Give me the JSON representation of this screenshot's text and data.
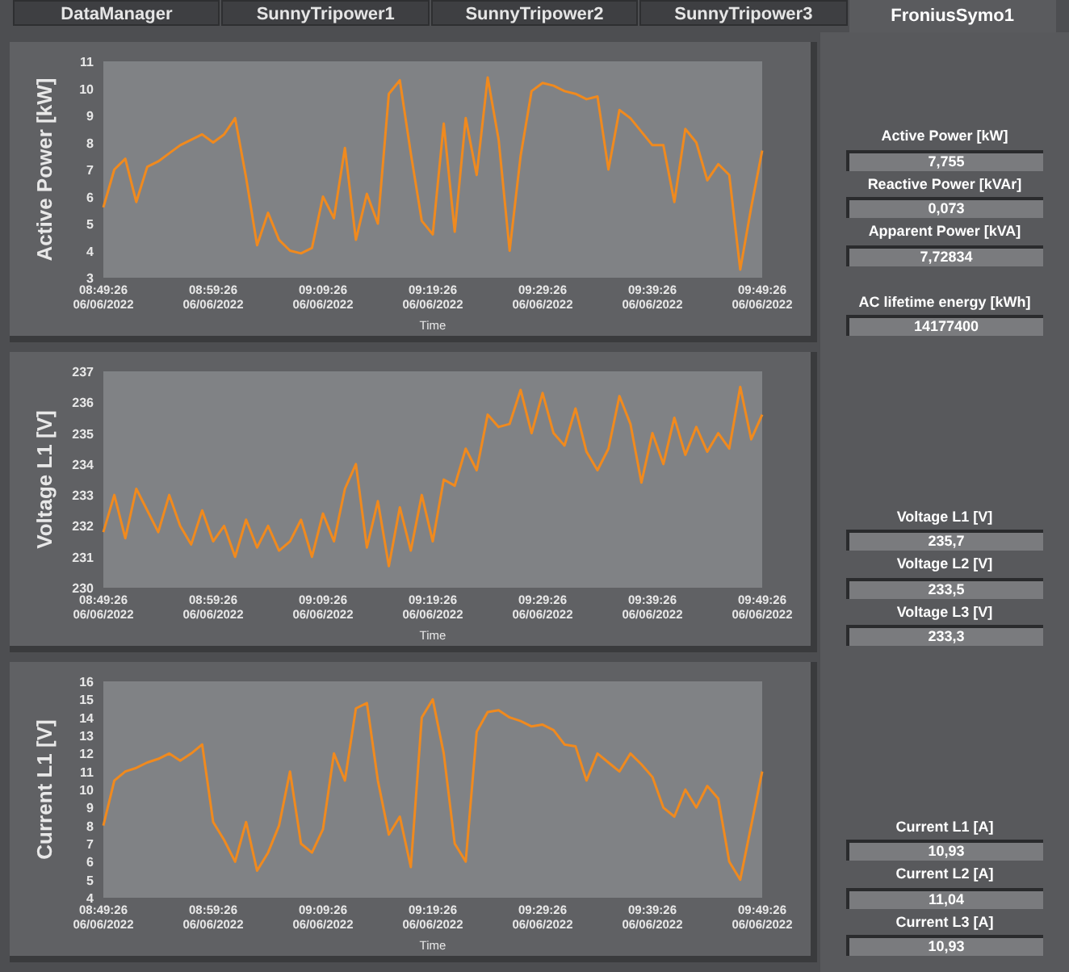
{
  "tabs": [
    {
      "label": "DataManager",
      "selected": false
    },
    {
      "label": "SunnyTripower1",
      "selected": false
    },
    {
      "label": "SunnyTripower2",
      "selected": false
    },
    {
      "label": "SunnyTripower3",
      "selected": false
    },
    {
      "label": "FroniusSymo1",
      "selected": true
    }
  ],
  "charts": [
    {
      "chart_data": {
        "type": "line",
        "xlabel": "Time",
        "ylabel": "Active Power [kW]",
        "categories": [
          "08:49:26\n06/06/2022",
          null,
          null,
          null,
          null,
          null,
          null,
          null,
          null,
          null,
          "08:59:26\n06/06/2022",
          null,
          null,
          null,
          null,
          null,
          null,
          null,
          null,
          null,
          "09:09:26\n06/06/2022",
          null,
          null,
          null,
          null,
          null,
          null,
          null,
          null,
          null,
          "09:19:26\n06/06/2022",
          null,
          null,
          null,
          null,
          null,
          null,
          null,
          null,
          null,
          "09:29:26\n06/06/2022",
          null,
          null,
          null,
          null,
          null,
          null,
          null,
          null,
          null,
          "09:39:26\n06/06/2022",
          null,
          null,
          null,
          null,
          null,
          null,
          null,
          null,
          null,
          "09:49:26\n06/06/2022"
        ],
        "series": [
          {
            "color": "#f08a1e",
            "values": [
              5.6,
              7.0,
              7.4,
              5.8,
              7.1,
              7.3,
              7.6,
              7.9,
              8.1,
              8.3,
              8.0,
              8.3,
              8.9,
              6.7,
              4.2,
              5.4,
              4.4,
              4.0,
              3.9,
              4.1,
              6.0,
              5.2,
              7.8,
              4.4,
              6.1,
              5.0,
              9.8,
              10.3,
              7.6,
              5.1,
              4.6,
              8.7,
              4.7,
              8.9,
              6.8,
              10.4,
              8.1,
              4.0,
              7.5,
              9.9,
              10.2,
              10.1,
              9.9,
              9.8,
              9.6,
              9.7,
              7.0,
              9.2,
              8.9,
              8.4,
              7.9,
              7.9,
              5.8,
              8.5,
              8.0,
              6.6,
              7.2,
              6.8,
              3.3,
              5.6,
              7.7
            ]
          }
        ],
        "ylim": [
          3,
          11
        ],
        "yticks": [
          3,
          4,
          5,
          6,
          7,
          8,
          9,
          10,
          11
        ]
      },
      "readouts": [
        {
          "label": "Active Power [kW]",
          "value": "7,755"
        },
        {
          "label": "Reactive Power [kVAr]",
          "value": "0,073"
        },
        {
          "label": "Apparent Power [kVA]",
          "value": "7,72834"
        },
        {
          "label": "AC lifetime energy [kWh]",
          "value": "14177400"
        }
      ]
    },
    {
      "chart_data": {
        "type": "line",
        "xlabel": "Time",
        "ylabel": "Voltage L1 [V]",
        "categories": [
          "08:49:26\n06/06/2022",
          null,
          null,
          null,
          null,
          null,
          null,
          null,
          null,
          null,
          "08:59:26\n06/06/2022",
          null,
          null,
          null,
          null,
          null,
          null,
          null,
          null,
          null,
          "09:09:26\n06/06/2022",
          null,
          null,
          null,
          null,
          null,
          null,
          null,
          null,
          null,
          "09:19:26\n06/06/2022",
          null,
          null,
          null,
          null,
          null,
          null,
          null,
          null,
          null,
          "09:29:26\n06/06/2022",
          null,
          null,
          null,
          null,
          null,
          null,
          null,
          null,
          null,
          "09:39:26\n06/06/2022",
          null,
          null,
          null,
          null,
          null,
          null,
          null,
          null,
          null,
          "09:49:26\n06/06/2022"
        ],
        "series": [
          {
            "color": "#f08a1e",
            "values": [
              231.8,
              233.0,
              231.6,
              233.2,
              232.5,
              231.8,
              233.0,
              232.0,
              231.4,
              232.5,
              231.5,
              232.0,
              231.0,
              232.2,
              231.3,
              232.0,
              231.2,
              231.5,
              232.2,
              231.0,
              232.4,
              231.5,
              233.2,
              234.0,
              231.3,
              232.8,
              230.7,
              232.6,
              231.2,
              233.0,
              231.5,
              233.5,
              233.3,
              234.5,
              233.8,
              235.6,
              235.2,
              235.3,
              236.4,
              235.0,
              236.3,
              235.0,
              234.6,
              235.8,
              234.4,
              233.8,
              234.5,
              236.2,
              235.3,
              233.4,
              235.0,
              234.0,
              235.5,
              234.3,
              235.2,
              234.4,
              235.0,
              234.5,
              236.5,
              234.8,
              235.6
            ]
          }
        ],
        "ylim": [
          230,
          237
        ],
        "yticks": [
          230,
          231,
          232,
          233,
          234,
          235,
          236,
          237
        ]
      },
      "readouts": [
        {
          "label": "Voltage L1 [V]",
          "value": "235,7"
        },
        {
          "label": "Voltage L2 [V]",
          "value": "233,5"
        },
        {
          "label": "Voltage L3 [V]",
          "value": "233,3"
        }
      ]
    },
    {
      "chart_data": {
        "type": "line",
        "xlabel": "Time",
        "ylabel": "Current L1 [V]",
        "categories": [
          "08:49:26\n06/06/2022",
          null,
          null,
          null,
          null,
          null,
          null,
          null,
          null,
          null,
          "08:59:26\n06/06/2022",
          null,
          null,
          null,
          null,
          null,
          null,
          null,
          null,
          null,
          "09:09:26\n06/06/2022",
          null,
          null,
          null,
          null,
          null,
          null,
          null,
          null,
          null,
          "09:19:26\n06/06/2022",
          null,
          null,
          null,
          null,
          null,
          null,
          null,
          null,
          null,
          "09:29:26\n06/06/2022",
          null,
          null,
          null,
          null,
          null,
          null,
          null,
          null,
          null,
          "09:39:26\n06/06/2022",
          null,
          null,
          null,
          null,
          null,
          null,
          null,
          null,
          null,
          "09:49:26\n06/06/2022"
        ],
        "series": [
          {
            "color": "#f08a1e",
            "values": [
              8,
              10.5,
              11,
              11.2,
              11.5,
              11.7,
              12,
              11.6,
              12,
              12.5,
              8.2,
              7.2,
              6,
              8.2,
              5.5,
              6.5,
              8,
              11,
              7,
              6.5,
              7.8,
              12,
              10.5,
              14.5,
              14.8,
              10.5,
              7.5,
              8.5,
              5.7,
              14,
              15,
              12,
              7,
              6,
              13.2,
              14.3,
              14.4,
              14,
              13.8,
              13.5,
              13.6,
              13.3,
              12.5,
              12.4,
              10.5,
              12,
              11.5,
              11,
              12,
              11.4,
              10.7,
              9,
              8.5,
              10,
              9,
              10.2,
              9.5,
              6,
              5,
              8,
              11
            ]
          }
        ],
        "ylim": [
          4,
          16
        ],
        "yticks": [
          4,
          5,
          6,
          7,
          8,
          9,
          10,
          11,
          12,
          13,
          14,
          15,
          16
        ]
      },
      "readouts": [
        {
          "label": "Current L1 [A]",
          "value": "10,93"
        },
        {
          "label": "Current L2 [A]",
          "value": "11,04"
        },
        {
          "label": "Current L3 [A]",
          "value": "10,93"
        }
      ]
    }
  ]
}
